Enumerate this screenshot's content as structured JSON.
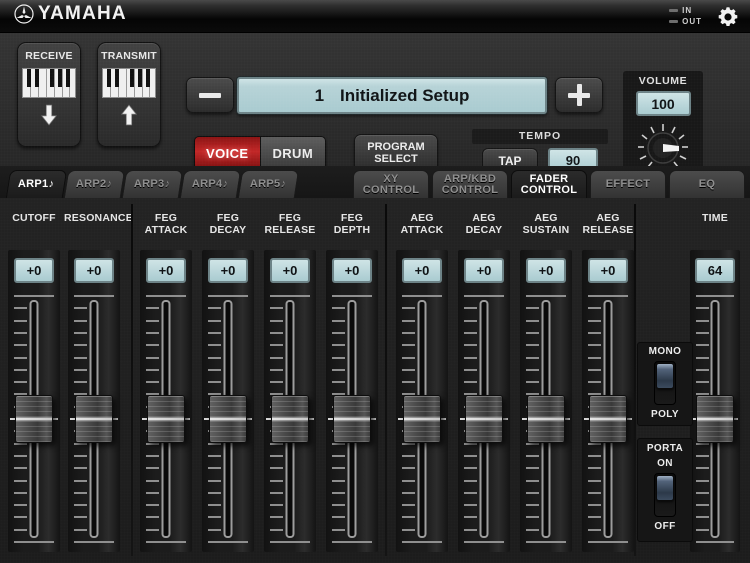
{
  "topbar": {
    "brand": "YAMAHA",
    "brand_logo_icon": "yamaha-tuning-fork-icon",
    "in_label": "IN",
    "out_label": "OUT",
    "settings_icon": "gear-icon"
  },
  "upper": {
    "receive": {
      "label": "RECEIVE",
      "icon": "keyboard-icon",
      "arrow": "arrow-down-icon"
    },
    "transmit": {
      "label": "TRANSMIT",
      "icon": "keyboard-icon",
      "arrow": "arrow-up-icon"
    },
    "minus_label": "−",
    "plus_label": "+",
    "program_display": {
      "number": "1",
      "name": "Initialized Setup"
    },
    "voice_label": "VOICE",
    "drum_label": "DRUM",
    "program_select_line1": "PROGRAM",
    "program_select_line2": "SELECT",
    "tempo": {
      "caption": "TEMPO",
      "tap_label": "TAP",
      "value": "90"
    },
    "volume": {
      "caption": "VOLUME",
      "value": "100"
    }
  },
  "tabs": {
    "left": [
      {
        "label": "ARP1",
        "glyph": "♪",
        "active": true
      },
      {
        "label": "ARP2",
        "glyph": "♪",
        "active": false
      },
      {
        "label": "ARP3",
        "glyph": "♪",
        "active": false
      },
      {
        "label": "ARP4",
        "glyph": "♪",
        "active": false
      },
      {
        "label": "ARP5",
        "glyph": "♪",
        "active": false
      }
    ],
    "right": [
      {
        "line1": "XY",
        "line2": "CONTROL",
        "active": false
      },
      {
        "line1": "ARP/KBD",
        "line2": "CONTROL",
        "active": false
      },
      {
        "line1": "FADER",
        "line2": "CONTROL",
        "active": true
      },
      {
        "line1": "EFFECT",
        "line2": "",
        "active": false
      },
      {
        "line1": "EQ",
        "line2": "",
        "active": false
      }
    ]
  },
  "faders": [
    {
      "line1": "CUTOFF",
      "line2": "",
      "value": "+0",
      "pos": 50
    },
    {
      "line1": "RESONANCE",
      "line2": "",
      "value": "+0",
      "pos": 50
    },
    {
      "line1": "FEG",
      "line2": "ATTACK",
      "value": "+0",
      "pos": 50
    },
    {
      "line1": "FEG",
      "line2": "DECAY",
      "value": "+0",
      "pos": 50
    },
    {
      "line1": "FEG",
      "line2": "RELEASE",
      "value": "+0",
      "pos": 50
    },
    {
      "line1": "FEG",
      "line2": "DEPTH",
      "value": "+0",
      "pos": 50
    },
    {
      "line1": "AEG",
      "line2": "ATTACK",
      "value": "+0",
      "pos": 50
    },
    {
      "line1": "AEG",
      "line2": "DECAY",
      "value": "+0",
      "pos": 50
    },
    {
      "line1": "AEG",
      "line2": "SUSTAIN",
      "value": "+0",
      "pos": 50
    },
    {
      "line1": "AEG",
      "line2": "RELEASE",
      "value": "+0",
      "pos": 50
    }
  ],
  "time_fader": {
    "line1": "TIME",
    "line2": "",
    "value": "64",
    "pos": 50
  },
  "switches": {
    "mono_poly": {
      "top": "MONO",
      "bottom": "POLY",
      "state": "MONO"
    },
    "porta": {
      "caption": "PORTA",
      "top": "ON",
      "bottom": "OFF",
      "state": "ON"
    }
  },
  "colors": {
    "lcd": "#b7d3d7",
    "lcd_border": "#6d8387",
    "voice_active": "#c22727",
    "panel": "#2b2b2b",
    "tick": "#8f8f8f"
  }
}
